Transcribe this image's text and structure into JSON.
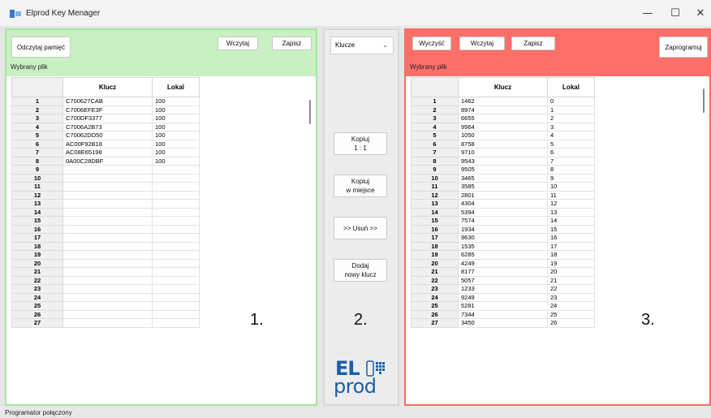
{
  "window": {
    "title": "Elprod Key Menager",
    "minimize": "—",
    "maximize": "☐",
    "close": "✕"
  },
  "left_panel": {
    "read_memory_btn": "Odczytaj pamięć",
    "load_btn": "Wczytaj",
    "save_btn": "Zapisz",
    "selected_file_label": "Wybrany plik",
    "columns": [
      "Klucz",
      "Lokal"
    ],
    "rows": [
      [
        "C700627CAB",
        "100"
      ],
      [
        "C7006EFE3F",
        "100"
      ],
      [
        "C700DF3377",
        "100"
      ],
      [
        "C7006A2B73",
        "100"
      ],
      [
        "C70062DD50",
        "100"
      ],
      [
        "AC00F92B18",
        "100"
      ],
      [
        "AC08E65198",
        "100"
      ],
      [
        "0A00C28DBF",
        "100"
      ],
      [
        "",
        ""
      ],
      [
        "",
        ""
      ],
      [
        "",
        ""
      ],
      [
        "",
        ""
      ],
      [
        "",
        ""
      ],
      [
        "",
        ""
      ],
      [
        "",
        ""
      ],
      [
        "",
        ""
      ],
      [
        "",
        ""
      ],
      [
        "",
        ""
      ],
      [
        "",
        ""
      ],
      [
        "",
        ""
      ],
      [
        "",
        ""
      ],
      [
        "",
        ""
      ],
      [
        "",
        ""
      ],
      [
        "",
        ""
      ],
      [
        "",
        ""
      ],
      [
        "",
        ""
      ],
      [
        "",
        ""
      ]
    ],
    "number": "1."
  },
  "middle_panel": {
    "select_value": "Klucze",
    "copy_1to1_line1": "Kopiuj",
    "copy_1to1_line2": "1 : 1",
    "copy_inplace_line1": "Kopiuj",
    "copy_inplace_line2": "w miejsce",
    "remove_btn": ">> Usuń >>",
    "add_key_line1": "Dodaj",
    "add_key_line2": "nowy klucz",
    "number": "2.",
    "logo_top": "EL",
    "logo_bottom": "prod"
  },
  "right_panel": {
    "clear_btn": "Wyczyść",
    "load_btn": "Wczytaj",
    "save_btn": "Zapisz",
    "program_btn": "Zaprogramuj",
    "selected_file_label": "Wybrany plik",
    "columns": [
      "Klucz",
      "Lokal"
    ],
    "rows": [
      [
        "1462",
        "0"
      ],
      [
        "8974",
        "1"
      ],
      [
        "6655",
        "2"
      ],
      [
        "9964",
        "3"
      ],
      [
        "1050",
        "4"
      ],
      [
        "8758",
        "5"
      ],
      [
        "9710",
        "6"
      ],
      [
        "9543",
        "7"
      ],
      [
        "9505",
        "8"
      ],
      [
        "3465",
        "9"
      ],
      [
        "3585",
        "10"
      ],
      [
        "2801",
        "11"
      ],
      [
        "4304",
        "12"
      ],
      [
        "5394",
        "13"
      ],
      [
        "7574",
        "14"
      ],
      [
        "1934",
        "15"
      ],
      [
        "9630",
        "16"
      ],
      [
        "1535",
        "17"
      ],
      [
        "6285",
        "18"
      ],
      [
        "4249",
        "19"
      ],
      [
        "8177",
        "20"
      ],
      [
        "5057",
        "21"
      ],
      [
        "1233",
        "22"
      ],
      [
        "9249",
        "23"
      ],
      [
        "5281",
        "24"
      ],
      [
        "7344",
        "25"
      ],
      [
        "3450",
        "26"
      ]
    ],
    "number": "3."
  },
  "status": {
    "text": "Programator połączony"
  },
  "colors": {
    "left_border": "#a7e6a1",
    "left_header": "#c8f0c2",
    "right_border": "#ff6b66",
    "right_header": "#ff6f6a",
    "logo_blue": "#1a5ea8"
  }
}
